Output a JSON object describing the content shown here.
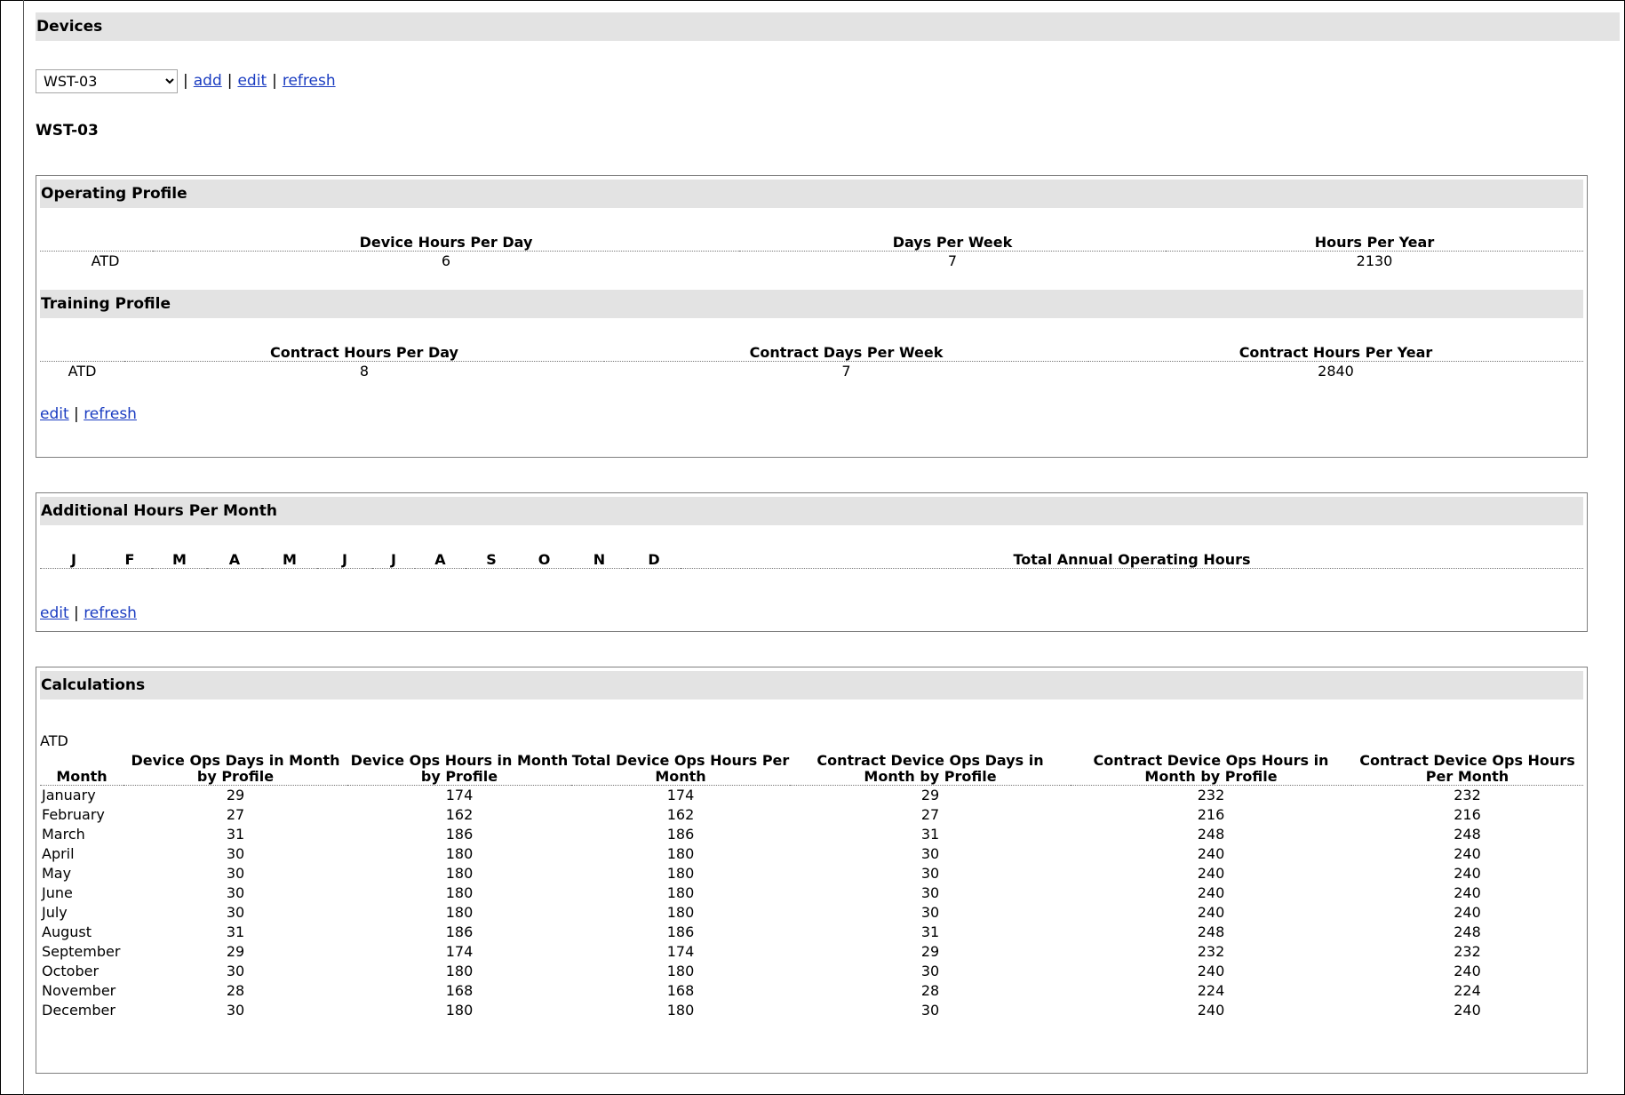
{
  "devices": {
    "title": "Devices",
    "selected": "WST-03",
    "links": [
      "add",
      "edit",
      "refresh"
    ],
    "device_name": "WST-03"
  },
  "operating_profile": {
    "title": "Operating Profile",
    "headers": [
      "",
      "Device Hours Per Day",
      "Days Per Week",
      "Hours Per Year"
    ],
    "row": [
      "ATD",
      "6",
      "7",
      "2130"
    ]
  },
  "training_profile": {
    "title": "Training Profile",
    "headers": [
      "",
      "Contract Hours Per Day",
      "Contract Days Per Week",
      "Contract Hours Per Year"
    ],
    "row": [
      "ATD",
      "8",
      "7",
      "2840"
    ],
    "links": [
      "edit",
      "refresh"
    ]
  },
  "additional_hours": {
    "title": "Additional Hours Per Month",
    "months": [
      "J",
      "F",
      "M",
      "A",
      "M",
      "J",
      "J",
      "A",
      "S",
      "O",
      "N",
      "D"
    ],
    "total_header": "Total Annual Operating Hours",
    "links": [
      "edit",
      "refresh"
    ]
  },
  "calculations": {
    "title": "Calculations",
    "group": "ATD",
    "headers": [
      "Month",
      "Device Ops Days in Month by Profile",
      "Device Ops Hours in Month by Profile",
      "Total Device Ops Hours Per Month",
      "Contract Device Ops Days in Month by Profile",
      "Contract Device Ops Hours in Month by Profile",
      "Contract Device Ops Hours Per Month"
    ],
    "rows": [
      [
        "January",
        "29",
        "174",
        "174",
        "29",
        "232",
        "232"
      ],
      [
        "February",
        "27",
        "162",
        "162",
        "27",
        "216",
        "216"
      ],
      [
        "March",
        "31",
        "186",
        "186",
        "31",
        "248",
        "248"
      ],
      [
        "April",
        "30",
        "180",
        "180",
        "30",
        "240",
        "240"
      ],
      [
        "May",
        "30",
        "180",
        "180",
        "30",
        "240",
        "240"
      ],
      [
        "June",
        "30",
        "180",
        "180",
        "30",
        "240",
        "240"
      ],
      [
        "July",
        "30",
        "180",
        "180",
        "30",
        "240",
        "240"
      ],
      [
        "August",
        "31",
        "186",
        "186",
        "31",
        "248",
        "248"
      ],
      [
        "September",
        "29",
        "174",
        "174",
        "29",
        "232",
        "232"
      ],
      [
        "October",
        "30",
        "180",
        "180",
        "30",
        "240",
        "240"
      ],
      [
        "November",
        "28",
        "168",
        "168",
        "28",
        "224",
        "224"
      ],
      [
        "December",
        "30",
        "180",
        "180",
        "30",
        "240",
        "240"
      ]
    ]
  }
}
